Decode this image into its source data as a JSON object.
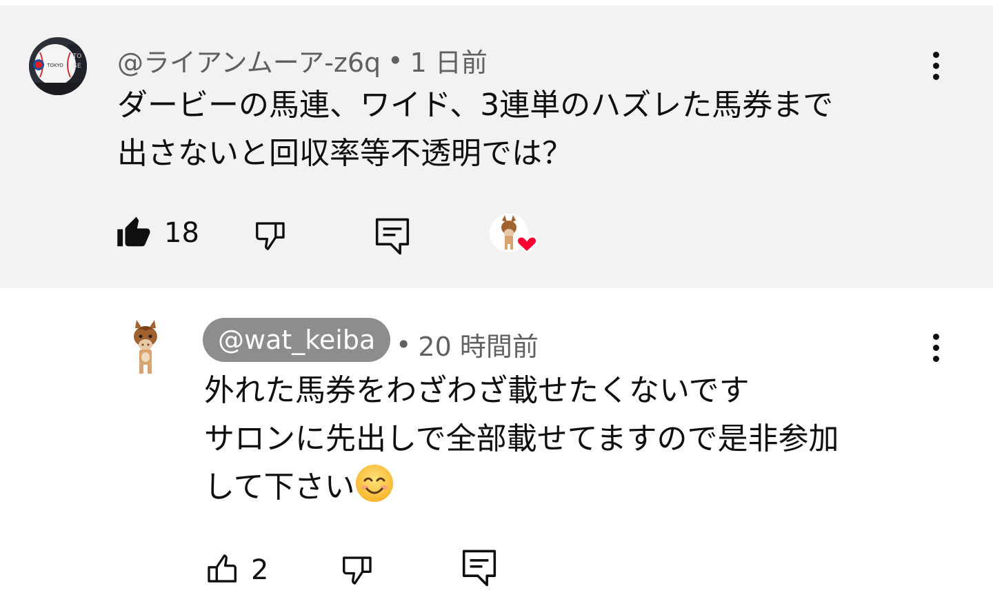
{
  "comment": {
    "author": "@ライアンムーア-z6q",
    "time": "1 日前",
    "lines": [
      "ダービーの馬連、ワイド、3連単のハズレた馬券まで",
      "出さないと回収率等不透明では？"
    ],
    "like_count": "18",
    "avatar_lettering": "TOKYO SE"
  },
  "reply": {
    "author": "@wat_keiba",
    "time": "20 時間前",
    "lines": [
      "外れた馬券をわざわざ載せたくないです",
      "サロンに先出しで全部載せてますので是非参加",
      "して下さい"
    ],
    "like_count": "2",
    "emoji": "smiling-face-emoji"
  },
  "separator": "•",
  "colors": {
    "highlight_bg": "#f2f2f2",
    "heart": "#ff0033",
    "handle_pill": "#8d8d8d",
    "meta_text": "#606060"
  }
}
